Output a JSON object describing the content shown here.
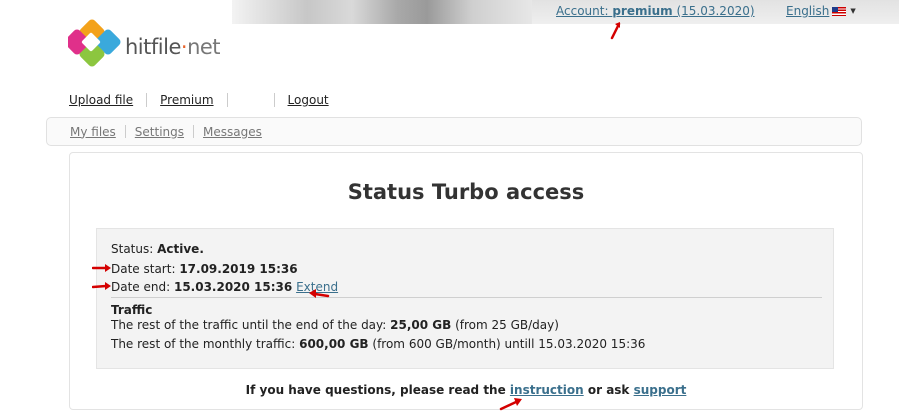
{
  "header": {
    "account_prefix": "Account: ",
    "account_plan": "premium",
    "account_expiry": "(15.03.2020)",
    "language": "English",
    "language_icon": "us-flag-icon",
    "logo_main": "hitfile",
    "logo_dot": "·",
    "logo_tld": "net"
  },
  "nav": {
    "upload": "Upload file",
    "premium": "Premium",
    "logout": "Logout"
  },
  "subnav": {
    "my_files": "My files",
    "settings": "Settings",
    "messages": "Messages"
  },
  "main": {
    "title": "Status Turbo access",
    "status_label": "Status: ",
    "status_value": "Active.",
    "date_start_label": "Date start: ",
    "date_start_value": "17.09.2019 15:36",
    "date_end_label": "Date end: ",
    "date_end_value": "15.03.2020 15:36",
    "extend_link": "Extend",
    "traffic_heading": "Traffic",
    "daily_label": "The rest of the traffic until the end of the day: ",
    "daily_value": "25,00 GB",
    "daily_note": " (from 25 GB/day)",
    "monthly_label": "The rest of the monthly traffic: ",
    "monthly_value": "600,00 GB",
    "monthly_note": " (from 600 GB/month) untill 15.03.2020 15:36"
  },
  "footer": {
    "text_before": "If you have questions, please read the ",
    "instruction_link": "instruction",
    "text_middle": " or ask ",
    "support_link": "support"
  },
  "colors": {
    "link": "#3a6f8c",
    "annotation_arrow": "#d40000"
  }
}
